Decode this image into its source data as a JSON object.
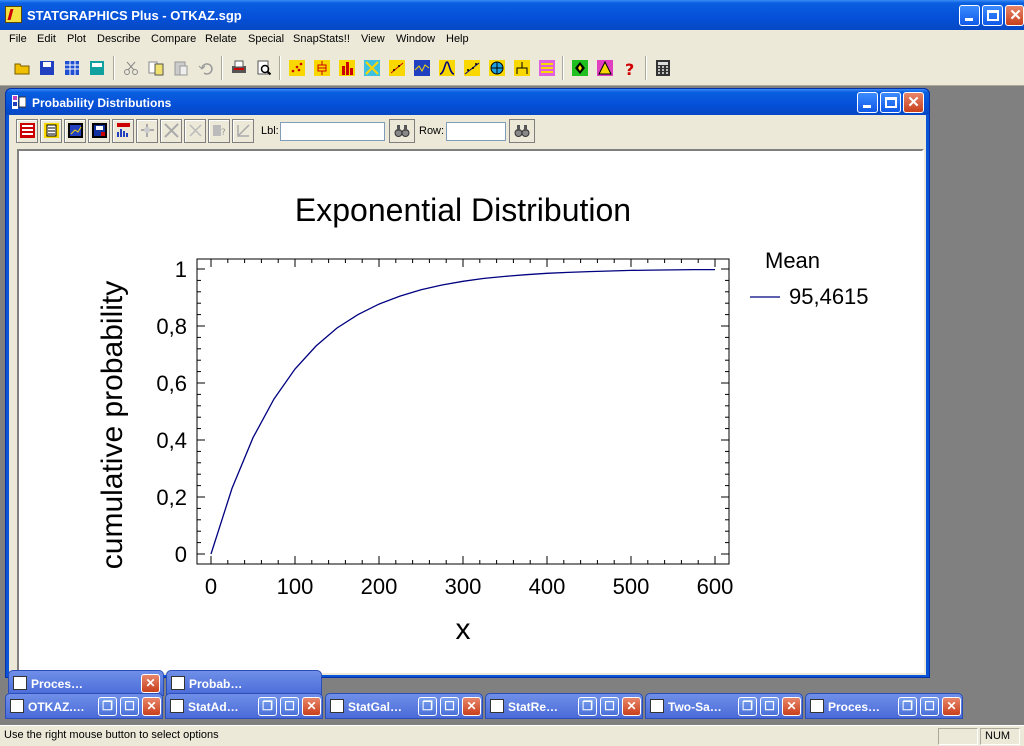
{
  "app": {
    "title": "STATGRAPHICS Plus - OTKAZ.sgp",
    "accent": "#0550d8"
  },
  "menu": [
    {
      "label": "File"
    },
    {
      "label": "Edit"
    },
    {
      "label": "Plot"
    },
    {
      "label": "Describe"
    },
    {
      "label": "Compare"
    },
    {
      "label": "Relate"
    },
    {
      "label": "Special"
    },
    {
      "label": "SnapStats!!"
    },
    {
      "label": "View"
    },
    {
      "label": "Window"
    },
    {
      "label": "Help"
    }
  ],
  "toolbar": {
    "icons": [
      "open-folder-icon",
      "save-disk-icon",
      "spreadsheet-icon",
      "data-save-icon",
      "cut-icon",
      "copy-icon",
      "paste-icon",
      "undo-icon",
      "print-icon",
      "print-preview-icon",
      "scatter-plot-icon",
      "box-plot-icon",
      "bar-chart-icon",
      "multi-plot-icon",
      "matrix-plot-icon",
      "line-plot-icon",
      "distribution-icon",
      "regression-icon",
      "globe-icon",
      "tree-icon",
      "glm-icon",
      "statadvisor-icon",
      "statwizard-icon",
      "help-question-icon",
      "calculator-icon"
    ]
  },
  "child_window": {
    "title": "Probability Distributions",
    "lbl_label": "Lbl:",
    "lbl_value": "",
    "row_label": "Row:",
    "row_value": ""
  },
  "chart_data": {
    "type": "line",
    "title": "Exponential Distribution",
    "xlabel": "x",
    "ylabel": "cumulative probability",
    "xlim": [
      0,
      600
    ],
    "ylim": [
      0,
      1
    ],
    "x_ticks": [
      "0",
      "100",
      "200",
      "300",
      "400",
      "500",
      "600"
    ],
    "y_ticks": [
      "0",
      "0,2",
      "0,4",
      "0,6",
      "0,8",
      "1"
    ],
    "legend_title": "Mean",
    "legend_placement": "right",
    "series": [
      {
        "name": "95,4615",
        "color": "#000080",
        "x": [
          0,
          25,
          50,
          75,
          100,
          125,
          150,
          175,
          200,
          225,
          250,
          275,
          300,
          325,
          350,
          375,
          400,
          425,
          450,
          475,
          500,
          525,
          550,
          575,
          600
        ],
        "values": [
          0,
          0.23,
          0.408,
          0.544,
          0.649,
          0.73,
          0.793,
          0.84,
          0.877,
          0.905,
          0.927,
          0.944,
          0.957,
          0.967,
          0.974,
          0.98,
          0.985,
          0.988,
          0.991,
          0.993,
          0.995,
          0.996,
          0.997,
          0.998,
          0.998
        ]
      }
    ]
  },
  "minimized_windows": [
    {
      "title": "Proces…"
    },
    {
      "title": "Probab…"
    },
    {
      "title": "OTKAZ.…"
    },
    {
      "title": "StatAd…"
    },
    {
      "title": "StatGal…"
    },
    {
      "title": "StatRe…"
    },
    {
      "title": "Two-Sa…"
    },
    {
      "title": "Proces…"
    }
  ],
  "statusbar": {
    "message": "Use the right mouse button to select options",
    "num": "NUM"
  }
}
